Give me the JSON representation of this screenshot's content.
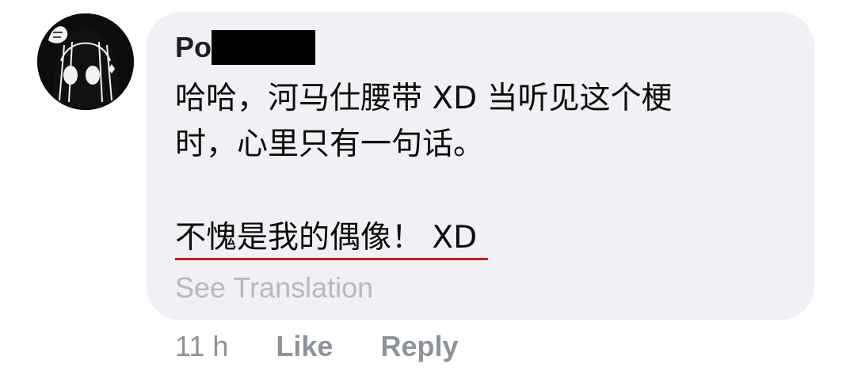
{
  "comment": {
    "author_visible": "Po",
    "author_redacted": true,
    "avatar_icon": "anime-girl-avatar-icon",
    "body_lines": [
      "哈哈，河马仕腰带 XD 当听见这个梗",
      "时，心里只有一句话。",
      "",
      "不愧是我的偶像！ XD"
    ],
    "see_translation": "See Translation",
    "timestamp": "11 h",
    "like_label": "Like",
    "reply_label": "Reply"
  },
  "colors": {
    "bubble_bg": "#f0f1f4",
    "text": "#0b0b0b",
    "muted": "#8d939b",
    "underline": "#d01a22"
  }
}
